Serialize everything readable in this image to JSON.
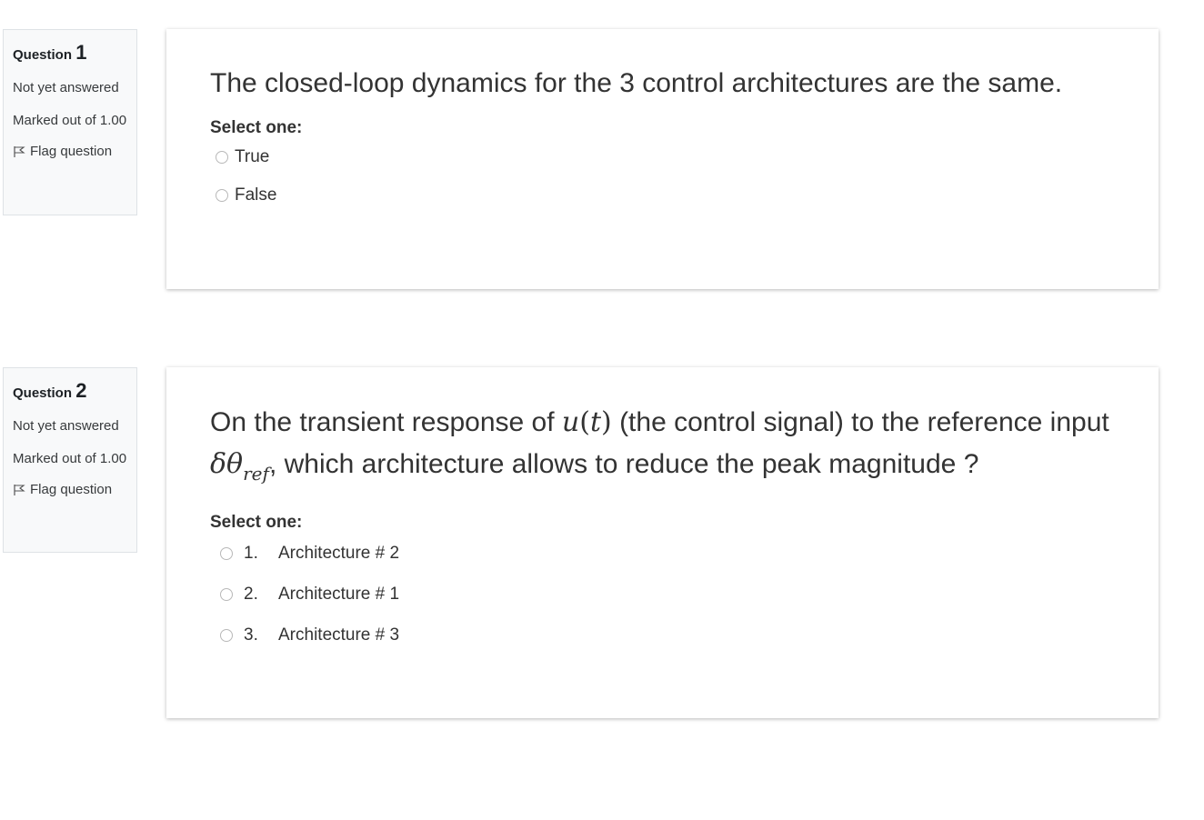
{
  "questions": [
    {
      "label": "Question",
      "number": "1",
      "state": "Not yet answered",
      "grade": "Marked out of 1.00",
      "flag_label": "Flag question",
      "text": "The closed-loop dynamics for the 3 control architectures are the same.",
      "prompt": "Select one:",
      "answers": [
        {
          "label": "True"
        },
        {
          "label": "False"
        }
      ]
    },
    {
      "label": "Question",
      "number": "2",
      "state": "Not yet answered",
      "grade": "Marked out of 1.00",
      "flag_label": "Flag question",
      "text_part1": "On the transient response of ",
      "math_u": "u",
      "math_paren_open": "(",
      "math_t": "t",
      "math_paren_close": ")",
      "text_part2": " (the control signal) to the reference input ",
      "math_delta_theta": "δθ",
      "math_sub": "ref",
      "text_part3": ", which architecture allows to reduce the peak magnitude ?",
      "prompt": "Select one:",
      "answers": [
        {
          "num": "1.",
          "label": "Architecture # 2"
        },
        {
          "num": "2.",
          "label": "Architecture # 1"
        },
        {
          "num": "3.",
          "label": "Architecture # 3"
        }
      ]
    }
  ]
}
